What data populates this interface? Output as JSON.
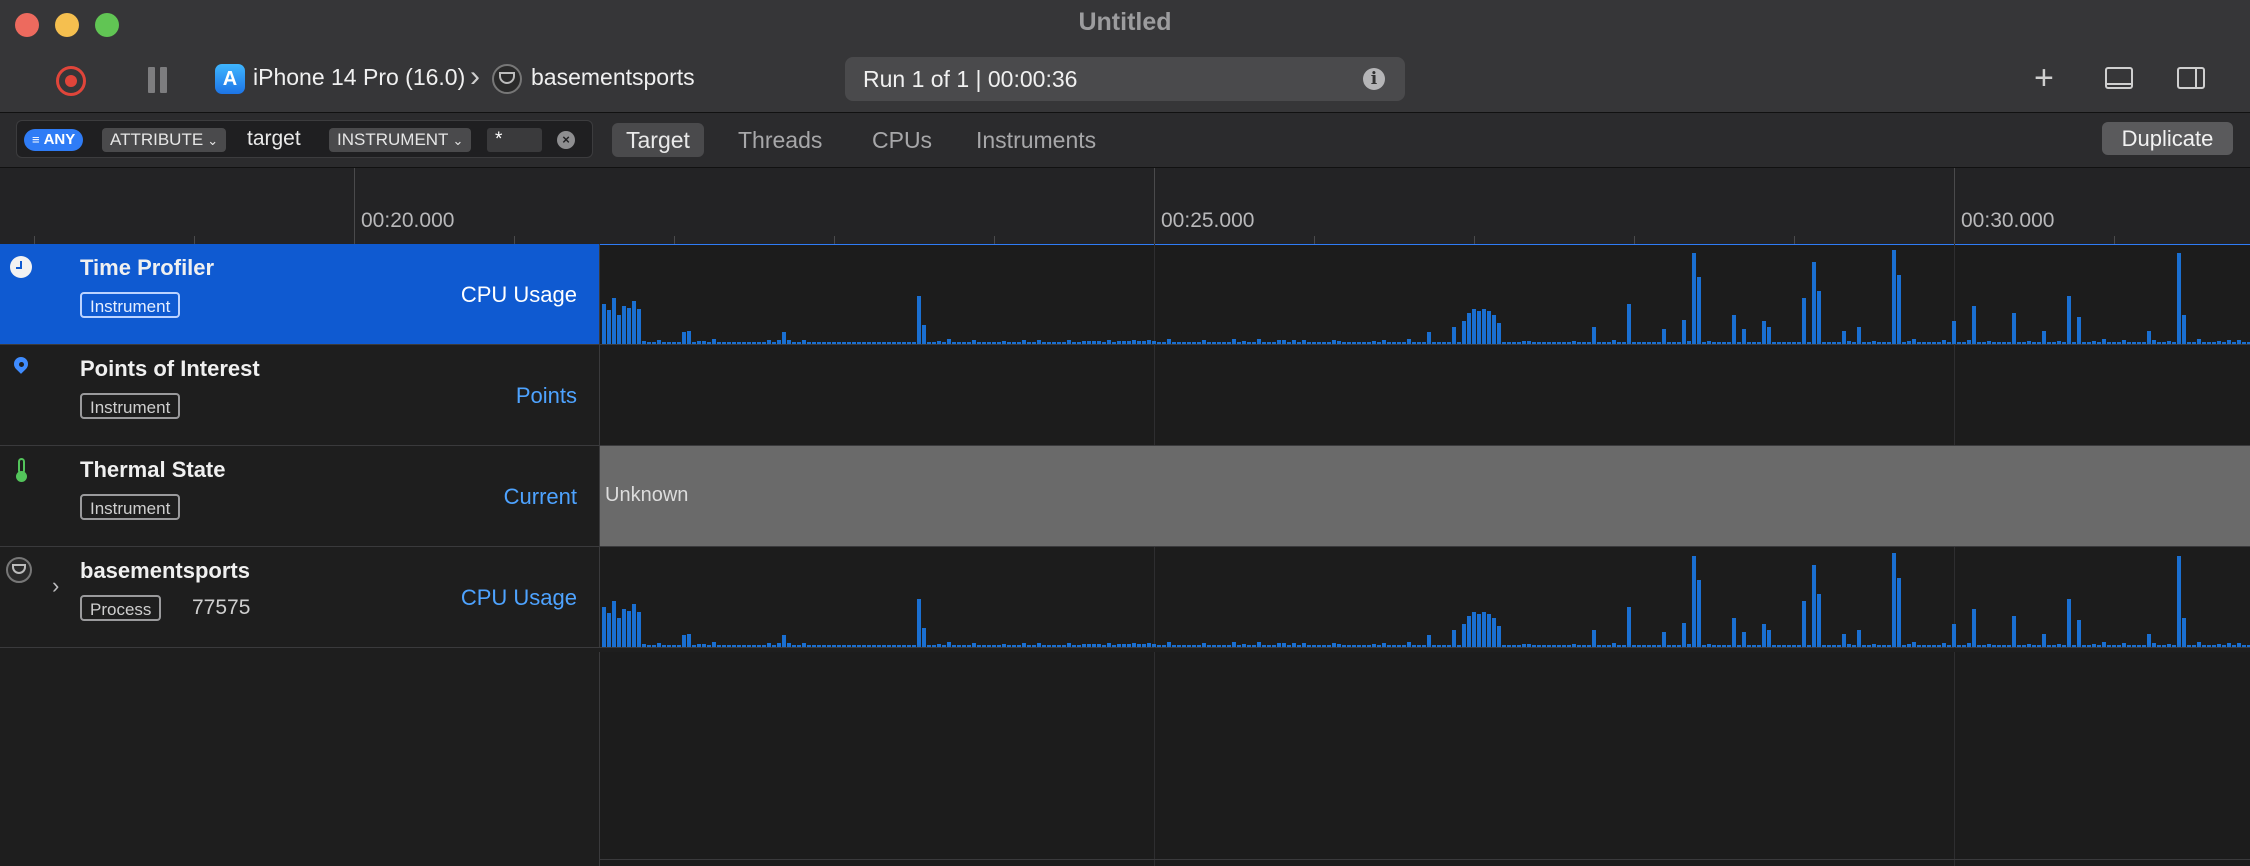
{
  "window": {
    "title": "Untitled"
  },
  "toolbar": {
    "device": "iPhone 14 Pro (16.0)",
    "app": "basementsports",
    "run_label": "Run 1 of 1  |  00:00:36"
  },
  "filter": {
    "any_label": "ANY",
    "attribute_label": "ATTRIBUTE",
    "value_text": "target",
    "instrument_label": "INSTRUMENT",
    "pattern": "*"
  },
  "scope_tabs": [
    "Target",
    "Threads",
    "CPUs",
    "Instruments"
  ],
  "duplicate_label": "Duplicate",
  "ruler": {
    "labels": [
      "00:20.000",
      "00:25.000",
      "00:30.000"
    ]
  },
  "tracks": [
    {
      "title": "Time Profiler",
      "badge": "Instrument",
      "metric": "CPU Usage",
      "icon": "clock-icon",
      "selected": true
    },
    {
      "title": "Points of Interest",
      "badge": "Instrument",
      "metric": "Points",
      "icon": "pin-icon"
    },
    {
      "title": "Thermal State",
      "badge": "Instrument",
      "metric": "Current",
      "icon": "thermometer-icon",
      "lane_text": "Unknown"
    },
    {
      "title": "basementsports",
      "badge": "Process",
      "pid": "77575",
      "metric": "CPU Usage",
      "icon": "app-icon"
    }
  ],
  "colors": {
    "accent": "#2f7cf6",
    "selected_row": "#0f5ad1",
    "cpu_bars": "#1a6fd1",
    "thermal_band": "#6a6a6a"
  }
}
